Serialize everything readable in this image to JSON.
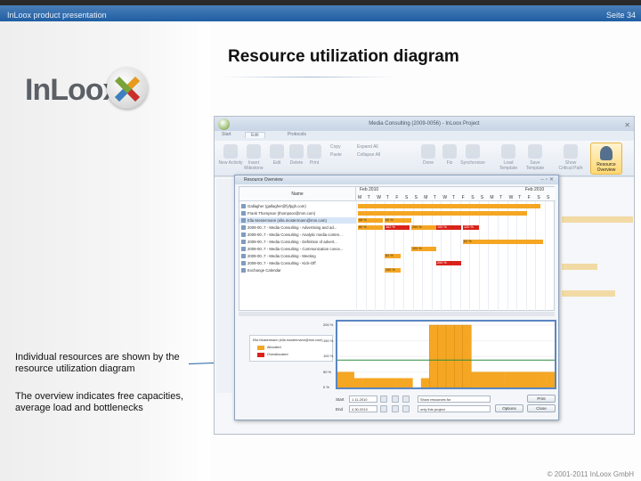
{
  "header": {
    "left": "InLoox product presentation",
    "right": "Seite 34"
  },
  "logo": {
    "text": "InLoox"
  },
  "title": "Resource utilization diagram",
  "desc": {
    "p1": "Individual resources are shown by the resource utilization diagram",
    "p2": "The overview indicates free capacities, average load and bottlenecks"
  },
  "footer": "© 2001-2011 InLoox GmbH",
  "app": {
    "window_title": "Media Consulting (2009-0056) - InLoox Project",
    "tabs": [
      "Start",
      "Edit",
      "Protocols"
    ],
    "active_tab": 1,
    "ribbon": {
      "buttons": [
        "New Activity",
        "Insert Milestone",
        "Edit",
        "Delete",
        "Print",
        "Done",
        "Fix",
        "Synchronize",
        "Load Template",
        "Save Template",
        "Show Critical Path"
      ],
      "small": [
        "Copy",
        "Paste",
        "Expand All",
        "Collapse All"
      ],
      "resource_overview": "Resource Overview"
    },
    "dialog": {
      "title": "Resource Overview",
      "name_header": "Name",
      "months": [
        "Feb 2010",
        "Feb 2010"
      ],
      "days": [
        "M",
        "T",
        "W",
        "T",
        "F",
        "S",
        "S",
        "M",
        "T",
        "W",
        "T",
        "F",
        "S",
        "S",
        "M",
        "T",
        "W",
        "T",
        "F",
        "S",
        "S"
      ],
      "rows": [
        "Gallagher (gallagher@fyfpgh.com)",
        "Frank Thompson (thompson@mm.com)",
        "Ella Mostermann (ella.mostermann@mm.com)",
        "2009-00..7 - Media Consulting - Advertising and ad...",
        "2009-00..7 - Media Consulting - Analytic media conten...",
        "2009-00..7 - Media Consulting - Definition of advert...",
        "2009-00..7 - Media Consulting - Communication conce...",
        "2009-00..7 - Media Consulting - Meeting",
        "2009-00..7 - Media Consulting - Kick-Off",
        "Exchange Calendar"
      ],
      "bars": [
        {
          "row": 0,
          "label": ""
        },
        {
          "row": 1,
          "label": ""
        },
        {
          "row": 2,
          "label": "68 %"
        },
        {
          "row": 2,
          "label": "60 %"
        },
        {
          "row": 3,
          "label": "80 %"
        },
        {
          "row": 3,
          "label": "13 %"
        },
        {
          "row": 3,
          "label": "162 %"
        },
        {
          "row": 3,
          "label": "200 %"
        },
        {
          "row": 3,
          "label": "100 %"
        },
        {
          "row": 3,
          "label": "120 %"
        },
        {
          "row": 5,
          "label": "62 %"
        },
        {
          "row": 6,
          "label": "100 %"
        },
        {
          "row": 7,
          "label": "62 %"
        },
        {
          "row": 8,
          "label": "200 %"
        },
        {
          "row": 9,
          "label": "100 %"
        }
      ],
      "legend": {
        "person": "Ella Mostermann (ella.mostermann@mm.com)",
        "items": [
          "Allocated",
          "Overallocated"
        ]
      },
      "utilization": {
        "y_ticks": [
          "200 %",
          "150 %",
          "100 %",
          "50 %",
          "0 %"
        ],
        "values": [
          50,
          50,
          30,
          30,
          30,
          30,
          30,
          30,
          30,
          0,
          30,
          200,
          200,
          200,
          200,
          200,
          50,
          50,
          50,
          50,
          50,
          50,
          50,
          50,
          50,
          50
        ],
        "avg_line": 88
      },
      "controls": {
        "start_label": "Start",
        "start_value": "1.11.2010",
        "end_label": "End",
        "end_value": "4.30.2010",
        "resource_dropdown": "Show resources for",
        "scope_dropdown": "only this project",
        "options_button": "Options",
        "close_button": "Close",
        "print_button": "Print"
      }
    }
  }
}
